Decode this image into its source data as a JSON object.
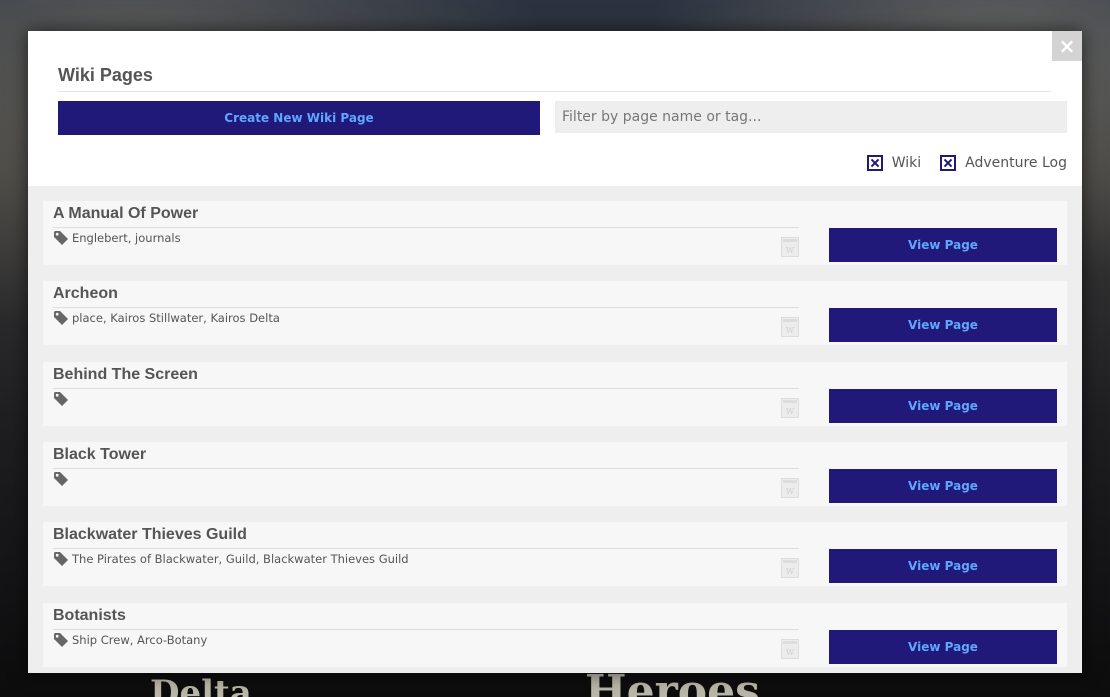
{
  "modal": {
    "title": "Wiki Pages",
    "close_label": "×",
    "create_button_label": "Create New Wiki Page",
    "filter_placeholder": "Filter by page name or tag...",
    "filter_value": "",
    "checkboxes": [
      {
        "label": "Wiki",
        "checked": true
      },
      {
        "label": "Adventure Log",
        "checked": true
      }
    ]
  },
  "pages": [
    {
      "title": "A Manual Of Power",
      "tags": "Englebert, journals",
      "button": "View Page"
    },
    {
      "title": "Archeon",
      "tags": "place, Kairos Stillwater, Kairos Delta",
      "button": "View Page"
    },
    {
      "title": "Behind The Screen",
      "tags": "",
      "button": "View Page"
    },
    {
      "title": "Black Tower",
      "tags": "",
      "button": "View Page"
    },
    {
      "title": "Blackwater Thieves Guild",
      "tags": "The Pirates of Blackwater, Guild, Blackwater Thieves Guild",
      "button": "View Page"
    },
    {
      "title": "Botanists",
      "tags": "Ship Crew, Arco-Botany",
      "button": "View Page"
    }
  ],
  "background": {
    "text_left": "Delta",
    "text_right": "Heroes"
  },
  "colors": {
    "accent": "#20197a",
    "button_text": "#5fa6ff",
    "card_bg": "#f7f7f7",
    "list_bg": "#eeeeee"
  },
  "icons": {
    "tag": "tag-icon",
    "page": "wiki-page-icon",
    "close": "close-icon",
    "checkbox": "checkbox-checked-icon"
  }
}
